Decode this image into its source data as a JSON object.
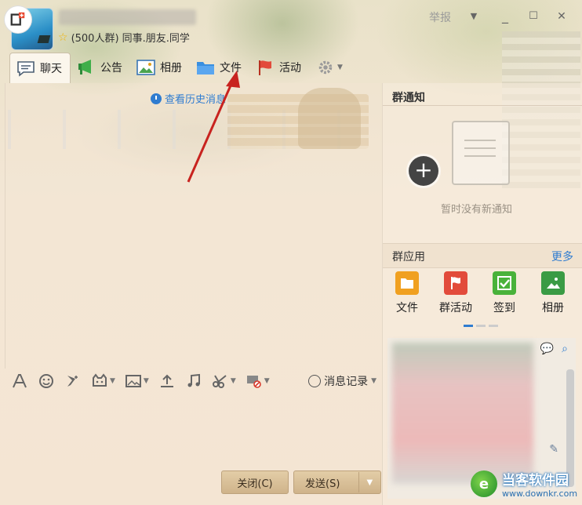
{
  "header": {
    "group_name": "(500人群) 同事.朋友.同学",
    "report": "举报",
    "minimize": "_",
    "maximize": "☐",
    "close": "✕",
    "chevron": "▼"
  },
  "tabs": [
    {
      "label": "聊天",
      "icon": "chat-bubble-icon",
      "active": true
    },
    {
      "label": "公告",
      "icon": "megaphone-icon"
    },
    {
      "label": "相册",
      "icon": "photo-icon"
    },
    {
      "label": "文件",
      "icon": "folder-icon"
    },
    {
      "label": "活动",
      "icon": "flag-icon"
    }
  ],
  "history_link": "查看历史消息",
  "toolbar": {
    "history_records": "消息记录"
  },
  "buttons": {
    "close": "关闭(C)",
    "send": "发送(S)"
  },
  "right_panel": {
    "notice_title": "群通知",
    "no_notice": "暂时没有新通知",
    "apps_title": "群应用",
    "more": "更多",
    "apps": [
      {
        "label": "文件",
        "color": "#f0a020"
      },
      {
        "label": "群活动",
        "color": "#e24b3b"
      },
      {
        "label": "签到",
        "color": "#49b23a"
      },
      {
        "label": "相册",
        "color": "#3a9b44"
      }
    ]
  },
  "watermark": {
    "name": "当客软件园",
    "url": "www.downkr.com"
  }
}
